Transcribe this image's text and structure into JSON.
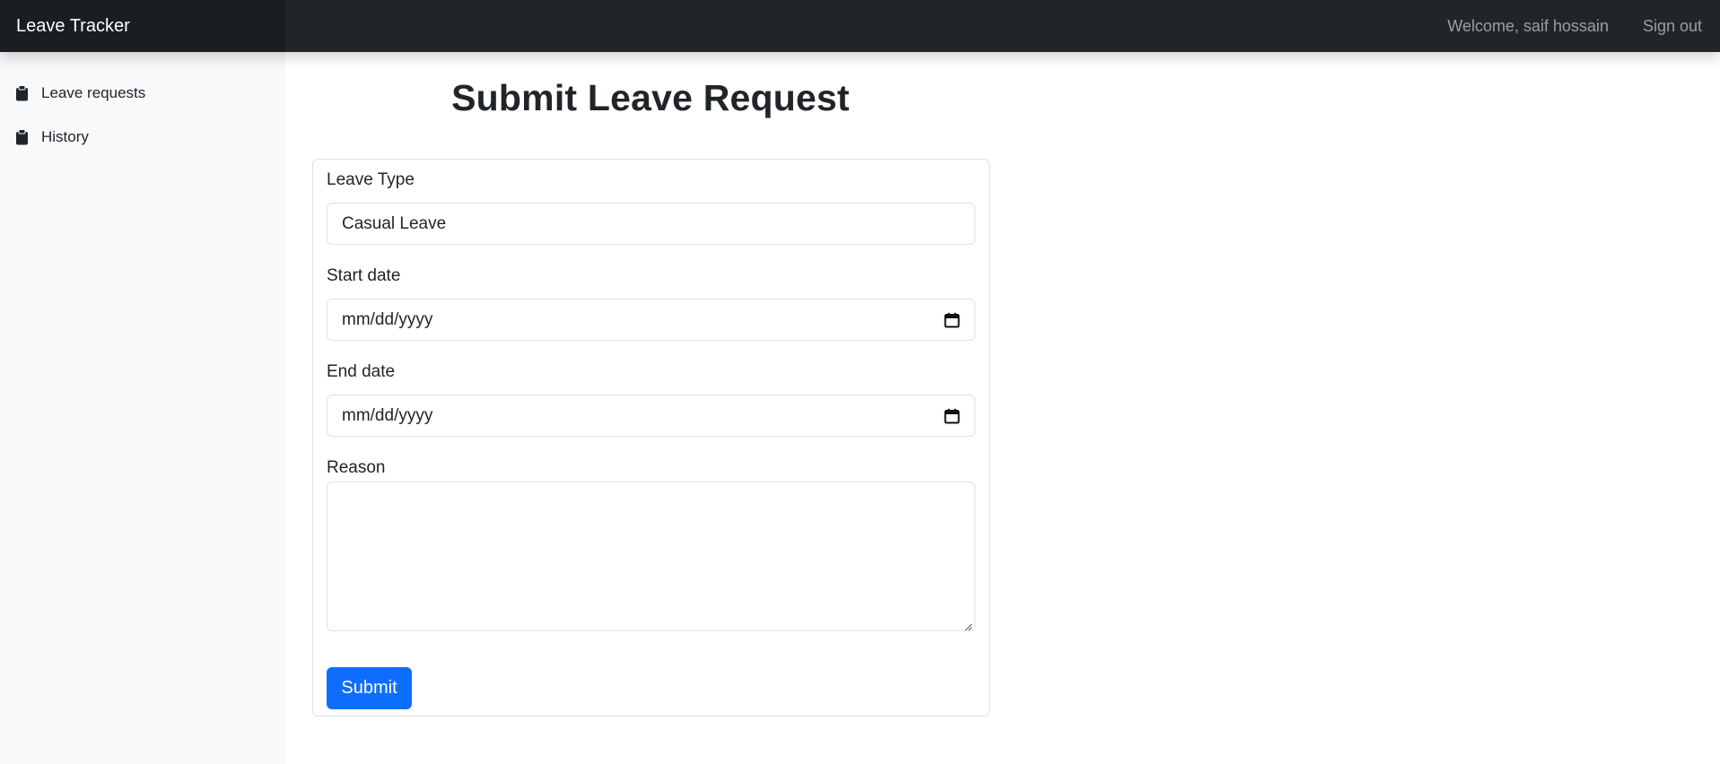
{
  "app": {
    "brand": "Leave Tracker"
  },
  "topnav": {
    "welcome": "Welcome, saif hossain",
    "signout": "Sign out"
  },
  "sidebar": {
    "items": [
      {
        "label": "Leave requests",
        "icon": "clipboard-icon"
      },
      {
        "label": "History",
        "icon": "clipboard-icon"
      }
    ]
  },
  "page": {
    "title": "Submit Leave Request"
  },
  "form": {
    "leave_type": {
      "label": "Leave Type",
      "value": "Casual Leave"
    },
    "start_date": {
      "label": "Start date",
      "placeholder": "mm/dd/yyyy"
    },
    "end_date": {
      "label": "End date",
      "placeholder": "mm/dd/yyyy"
    },
    "reason": {
      "label": "Reason",
      "value": ""
    },
    "submit_label": "Submit"
  },
  "colors": {
    "topbar": "#212529",
    "sidebar": "#f8f9fa",
    "primary": "#0d6efd",
    "border": "#dee2e6"
  }
}
